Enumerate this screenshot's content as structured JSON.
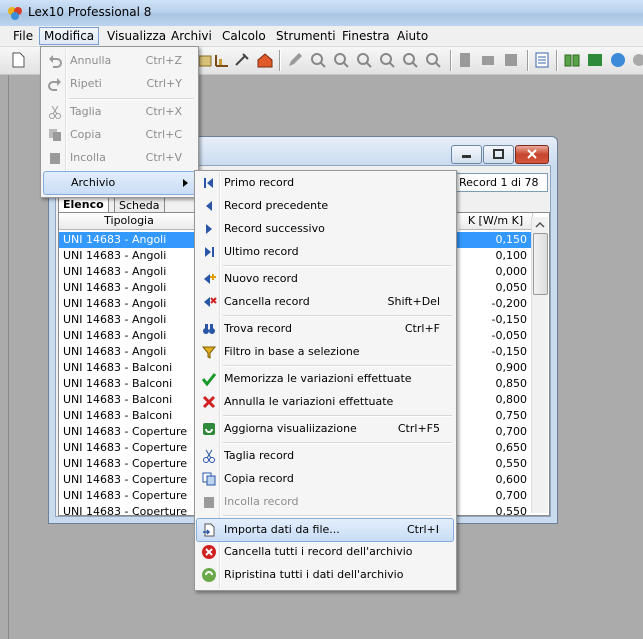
{
  "app": {
    "title": "Lex10 Professional 8"
  },
  "menubar": {
    "items": [
      {
        "label": "File"
      },
      {
        "label": "Modifica"
      },
      {
        "label": "Visualizza"
      },
      {
        "label": "Archivi"
      },
      {
        "label": "Calcolo"
      },
      {
        "label": "Strumenti"
      },
      {
        "label": "Finestra"
      },
      {
        "label": "Aiuto"
      }
    ]
  },
  "modifica_menu": {
    "items": [
      {
        "label": "Annulla",
        "shortcut": "Ctrl+Z"
      },
      {
        "label": "Ripeti",
        "shortcut": "Ctrl+Y"
      },
      {
        "label": "Taglia",
        "shortcut": "Ctrl+X"
      },
      {
        "label": "Copia",
        "shortcut": "Ctrl+C"
      },
      {
        "label": "Incolla",
        "shortcut": "Ctrl+V"
      },
      {
        "label": "Archivio",
        "shortcut": ""
      }
    ]
  },
  "archivio_menu": {
    "items": [
      {
        "label": "Primo record",
        "shortcut": ""
      },
      {
        "label": "Record precedente",
        "shortcut": ""
      },
      {
        "label": "Record successivo",
        "shortcut": ""
      },
      {
        "label": "Ultimo record",
        "shortcut": ""
      },
      {
        "label": "Nuovo record",
        "shortcut": ""
      },
      {
        "label": "Cancella record",
        "shortcut": "Shift+Del"
      },
      {
        "label": "Trova record",
        "shortcut": "Ctrl+F"
      },
      {
        "label": "Filtro in base a selezione",
        "shortcut": ""
      },
      {
        "label": "Memorizza le variazioni effettuate",
        "shortcut": ""
      },
      {
        "label": "Annulla le variazioni effettuate",
        "shortcut": ""
      },
      {
        "label": "Aggiorna visualiizazione",
        "shortcut": "Ctrl+F5"
      },
      {
        "label": "Taglia record",
        "shortcut": ""
      },
      {
        "label": "Copia  record",
        "shortcut": ""
      },
      {
        "label": "Incolla record",
        "shortcut": ""
      },
      {
        "label": "Importa dati da file...",
        "shortcut": "Ctrl+I"
      },
      {
        "label": "Cancella tutti i record dell'archivio",
        "shortcut": ""
      },
      {
        "label": "Ripristina tutti i dati dell'archivio",
        "shortcut": ""
      }
    ]
  },
  "child_window": {
    "record_indicator": "Record 1 di 78",
    "tabs": [
      {
        "label": "Elenco"
      },
      {
        "label": "Scheda"
      }
    ],
    "columns": [
      "Tipologia",
      "K [W/m K]"
    ],
    "rows": [
      {
        "tipologia": "UNI 14683 - Angoli",
        "k": "0,150"
      },
      {
        "tipologia": "UNI 14683 - Angoli",
        "k": "0,100"
      },
      {
        "tipologia": "UNI 14683 - Angoli",
        "k": "0,000"
      },
      {
        "tipologia": "UNI 14683 - Angoli",
        "k": "0,050"
      },
      {
        "tipologia": "UNI 14683 - Angoli",
        "k": "-0,200"
      },
      {
        "tipologia": "UNI 14683 - Angoli",
        "k": "-0,150"
      },
      {
        "tipologia": "UNI 14683 - Angoli",
        "k": "-0,050"
      },
      {
        "tipologia": "UNI 14683 - Angoli",
        "k": "-0,150"
      },
      {
        "tipologia": "UNI 14683 - Balconi",
        "k": "0,900"
      },
      {
        "tipologia": "UNI 14683 - Balconi",
        "k": "0,850"
      },
      {
        "tipologia": "UNI 14683 - Balconi",
        "k": "0,800"
      },
      {
        "tipologia": "UNI 14683 - Balconi",
        "k": "0,750"
      },
      {
        "tipologia": "UNI 14683 - Coperture",
        "k": "0,700"
      },
      {
        "tipologia": "UNI 14683 - Coperture",
        "k": "0,650"
      },
      {
        "tipologia": "UNI 14683 - Coperture",
        "k": "0,550"
      },
      {
        "tipologia": "UNI 14683 - Coperture",
        "k": "0,600"
      },
      {
        "tipologia": "UNI 14683 - Coperture",
        "k": "0,700"
      },
      {
        "tipologia": "UNI 14683 - Coperture",
        "k": "0,550"
      }
    ]
  }
}
